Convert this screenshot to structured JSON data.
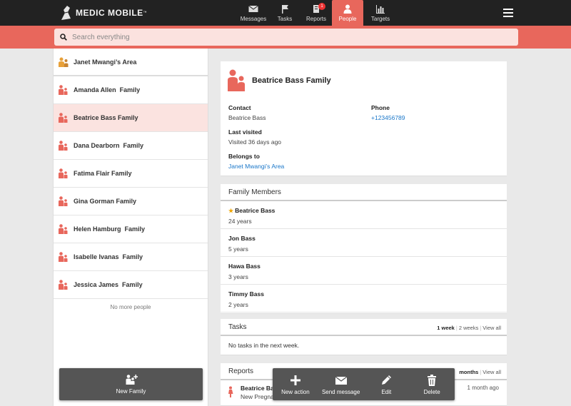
{
  "brand": {
    "name": "MEDIC MOBILE",
    "tm": "™"
  },
  "nav": [
    {
      "label": "Messages",
      "icon": "envelope-icon"
    },
    {
      "label": "Tasks",
      "icon": "flag-icon"
    },
    {
      "label": "Reports",
      "icon": "reports-icon",
      "badge": "1"
    },
    {
      "label": "People",
      "icon": "person-icon",
      "active": true
    },
    {
      "label": "Targets",
      "icon": "bar-chart-icon"
    }
  ],
  "search": {
    "placeholder": "Search everything"
  },
  "people_list": {
    "area": "Janet Mwangi’s Area",
    "families": [
      "Amanda Allen  Family",
      "Beatrice Bass Family",
      "Dana Dearborn  Family",
      "Fatima Flair Family",
      "Gina Gorman Family",
      "Helen Hamburg  Family",
      "Isabelle Ivanas  Family",
      "Jessica James  Family"
    ],
    "selected_index": 1,
    "no_more": "No more people",
    "new_family": "New Family"
  },
  "summary": {
    "name": "Beatrice Bass Family",
    "contact_label": "Contact",
    "contact_value": "Beatrice Bass",
    "phone_label": "Phone",
    "phone_value": "+123456789",
    "last_visited_label": "Last visited",
    "last_visited_value": "Visited 36 days ago",
    "belongs_to_label": "Belongs to",
    "belongs_to_value": "Janet Mwangi’s Area"
  },
  "members": {
    "title": "Family Members",
    "items": [
      {
        "name": "Beatrice Bass",
        "age": "24 years",
        "primary": true
      },
      {
        "name": "Jon Bass",
        "age": "5 years"
      },
      {
        "name": "Hawa Bass",
        "age": "3 years"
      },
      {
        "name": "Timmy Bass",
        "age": "2 years"
      }
    ]
  },
  "tasks": {
    "title": "Tasks",
    "filter_week": "1 week",
    "filter_2weeks": "2 weeks",
    "filter_all": "View all",
    "empty": "No tasks in the next week."
  },
  "reports": {
    "title": "Reports",
    "filter_months": "months",
    "filter_all": "View all",
    "item_title": "Beatrice Ba",
    "item_sub": "New Pregnancy",
    "item_time": "1 month ago"
  },
  "actions": {
    "new_action": "New action",
    "send_message": "Send message",
    "edit": "Edit",
    "delete": "Delete"
  },
  "colors": {
    "accent": "#e8675c",
    "topbar": "#222222",
    "selected_row": "#fbe3e0",
    "link": "#1a77c9"
  }
}
